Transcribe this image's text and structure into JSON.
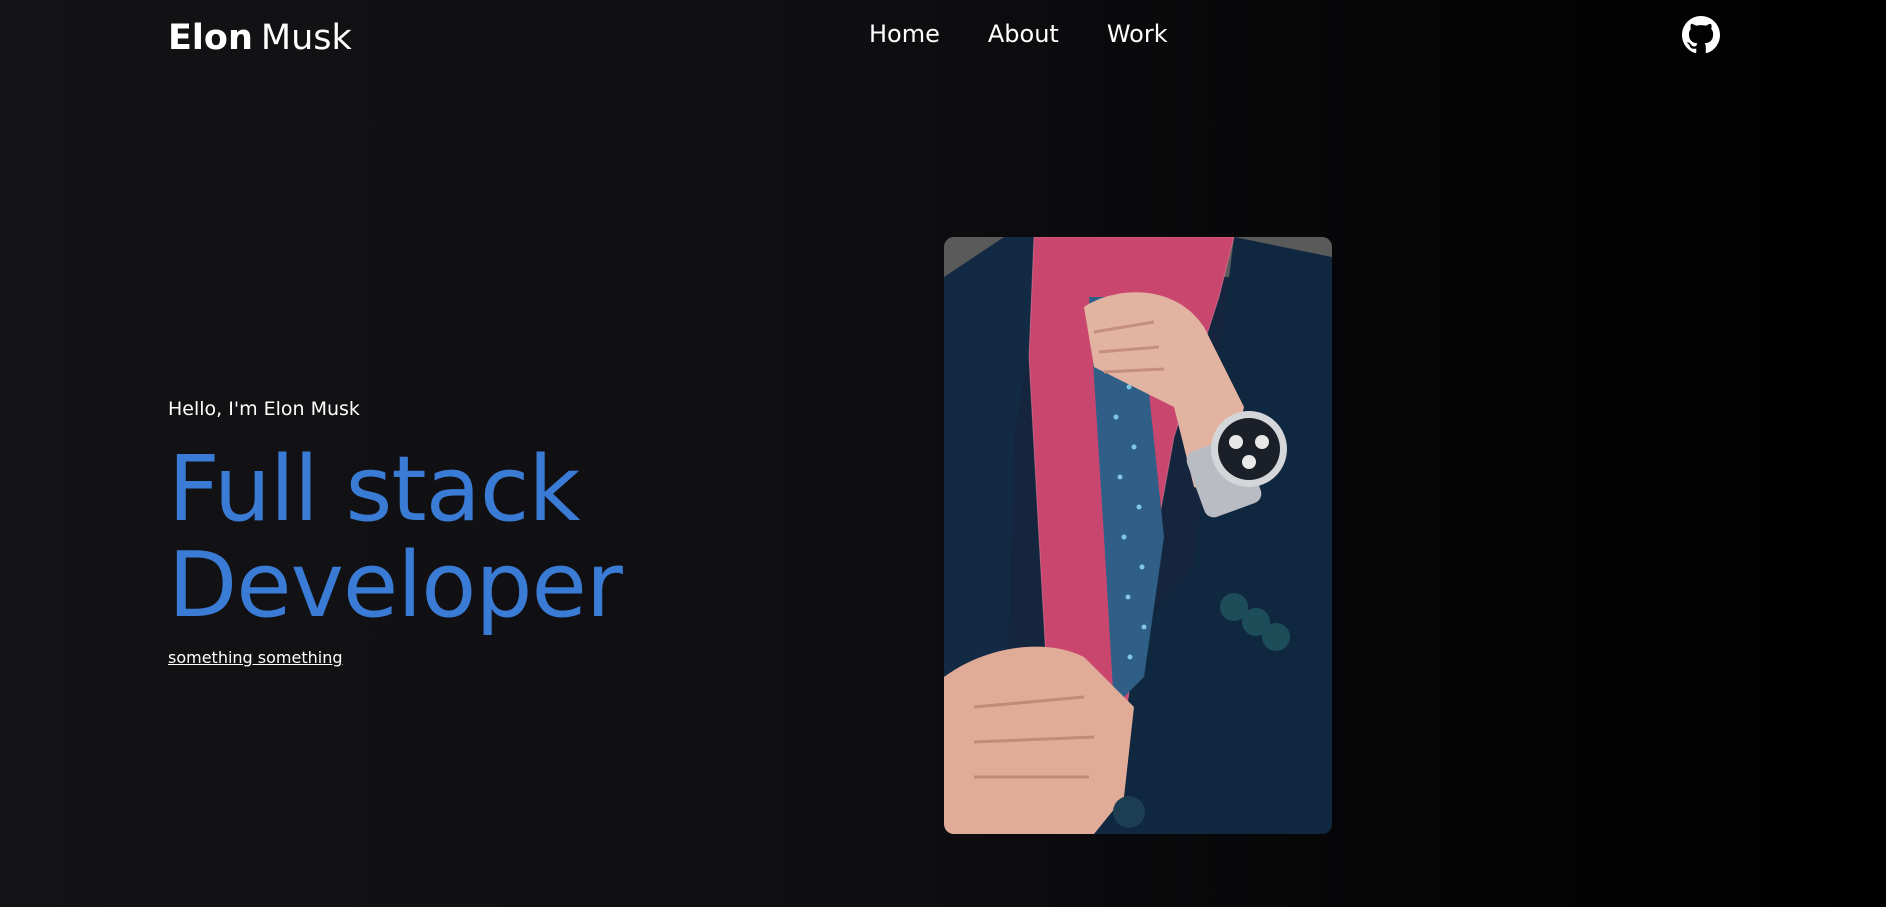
{
  "brand": {
    "first": "Elon",
    "last": "Musk"
  },
  "nav": {
    "items": [
      {
        "label": "Home"
      },
      {
        "label": "About"
      },
      {
        "label": "Work"
      }
    ],
    "github_icon": "github-icon"
  },
  "hero": {
    "greeting": "Hello, I'm Elon Musk",
    "title_line1": "Full stack",
    "title_line2": "Developer",
    "link": "something something",
    "image_icon": "portrait-photo"
  },
  "colors": {
    "accent": "#3a7bd5",
    "text": "#ffffff",
    "background": "#131316"
  }
}
